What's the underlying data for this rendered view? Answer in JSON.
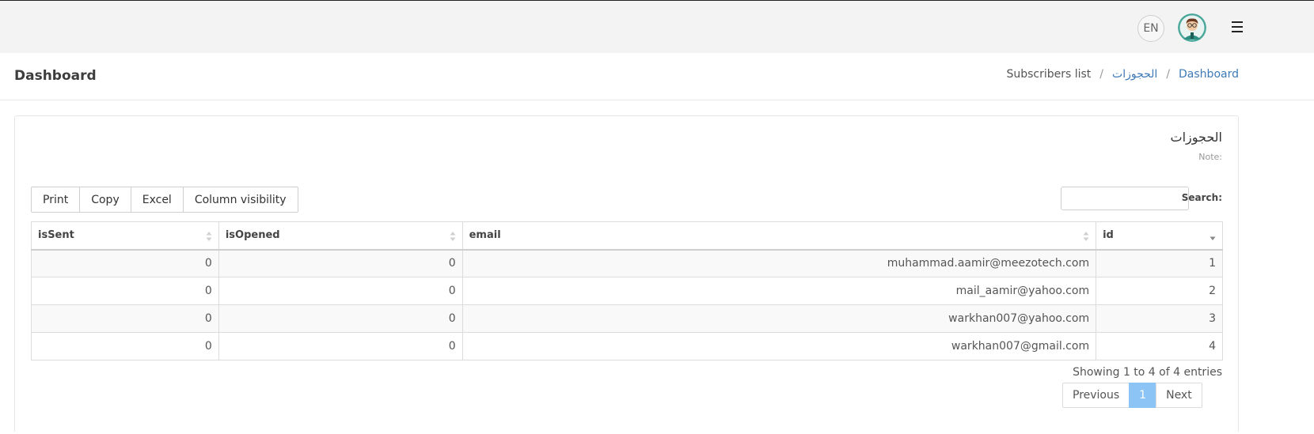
{
  "topbar": {
    "language_label": "EN"
  },
  "header": {
    "title": "Dashboard",
    "breadcrumb": {
      "home": "Dashboard",
      "section": "الحجوزات",
      "current": "Subscribers list",
      "separator": "/"
    }
  },
  "card": {
    "title": "الحجوزات",
    "note": "Note:"
  },
  "toolbar": {
    "buttons": [
      "Print",
      "Copy",
      "Excel",
      "Column visibility"
    ]
  },
  "search": {
    "label": "Search:",
    "value": "",
    "placeholder": ""
  },
  "table": {
    "columns": [
      "isSent",
      "isOpened",
      "email",
      "id"
    ],
    "rows": [
      {
        "isSent": "0",
        "isOpened": "0",
        "email": "muhammad.aamir@meezotech.com",
        "id": "1"
      },
      {
        "isSent": "0",
        "isOpened": "0",
        "email": "mail_aamir@yahoo.com",
        "id": "2"
      },
      {
        "isSent": "0",
        "isOpened": "0",
        "email": "warkhan007@yahoo.com",
        "id": "3"
      },
      {
        "isSent": "0",
        "isOpened": "0",
        "email": "warkhan007@gmail.com",
        "id": "4"
      }
    ]
  },
  "footer": {
    "info": "Showing 1 to 4 of 4 entries",
    "pagination": {
      "previous": "Previous",
      "current_page": "1",
      "next": "Next"
    }
  },
  "colors": {
    "topbar_bg": "#f3f3f3",
    "link": "#3e7ab8",
    "active_page": "#8cc4f6",
    "striped_row": "#f9f9f9"
  },
  "icons": {
    "avatar": "user-avatar",
    "menu": "hamburger-menu-icon",
    "sort": "sort-both-icon",
    "sort_active": "sort-desc-icon"
  }
}
